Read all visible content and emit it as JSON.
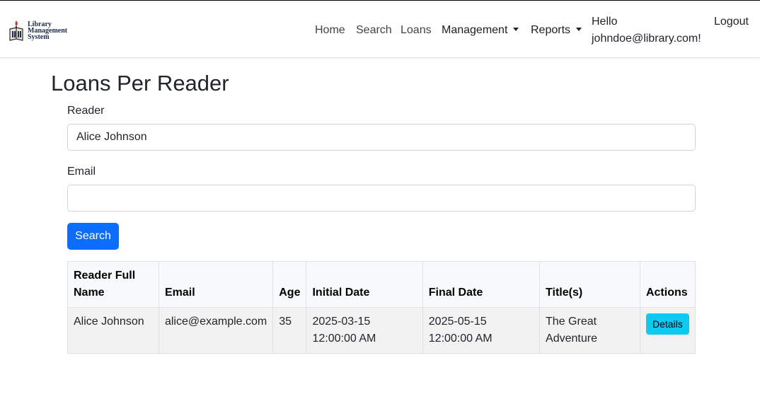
{
  "brand": {
    "line1": "Library",
    "line2": "Management",
    "line3": "System",
    "icon": "library-logo-icon"
  },
  "nav": {
    "home": "Home",
    "search": "Search",
    "loans": "Loans",
    "management": "Management",
    "reports": "Reports",
    "hello_line1": "Hello",
    "hello_line2": "johndoe@library.com!",
    "logout": "Logout"
  },
  "page": {
    "title": "Loans Per Reader"
  },
  "form": {
    "reader_label": "Reader",
    "reader_value": "Alice Johnson",
    "email_label": "Email",
    "email_value": "",
    "search_button": "Search"
  },
  "table": {
    "headers": [
      "Reader Full Name",
      "Email",
      "Age",
      "Initial Date",
      "Final Date",
      "Title(s)",
      "Actions"
    ],
    "rows": [
      {
        "name": "Alice Johnson",
        "email": "alice@example.com",
        "age": "35",
        "initial_date": "2025-03-15 12:00:00 AM",
        "final_date": "2025-05-15 12:00:00 AM",
        "titles": "The Great Adventure",
        "action": "Details"
      }
    ]
  },
  "colors": {
    "primary": "#0d6efd",
    "info": "#0dcaf0",
    "brand_navy": "#1b2a4a",
    "brand_red": "#c0392b"
  }
}
